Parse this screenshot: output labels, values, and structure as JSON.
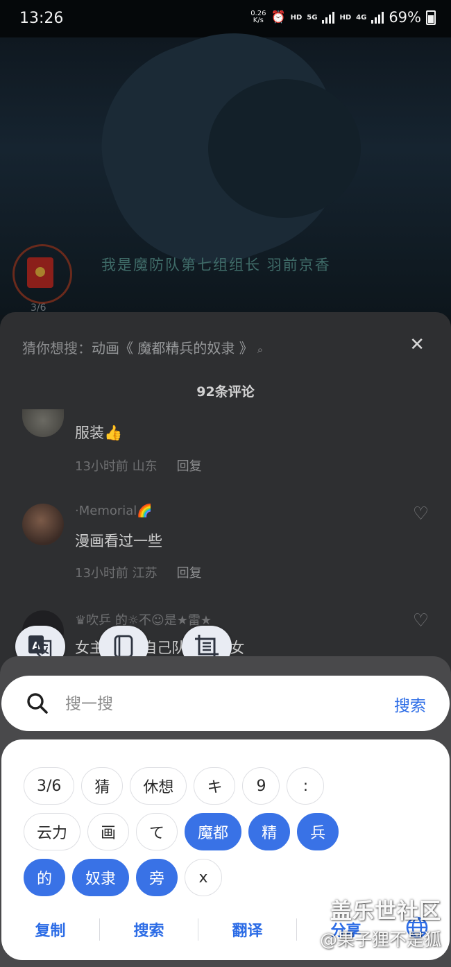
{
  "status_bar": {
    "time": "13:26",
    "net_speed_value": "0.26",
    "net_speed_unit": "K/s",
    "hd1": "HD",
    "net5g": "5G",
    "hd2": "HD",
    "net4g": "4G",
    "battery": "69%"
  },
  "video": {
    "subtitle": "我是魔防队第七组组长 羽前京香",
    "red_packet_count": "3/6"
  },
  "sheet": {
    "suggest_label": "猜你想搜：",
    "suggest_keyword": "动画《 魔都精兵的奴隶 》",
    "close": "✕",
    "comment_count": "92条评论",
    "comments": [
      {
        "text": "服装👍",
        "time": "13小时前",
        "region": "山东",
        "reply": "回复"
      },
      {
        "user": "·Memorial🌈",
        "text": "漫画看过一些",
        "time": "13小时前",
        "region": "江苏",
        "reply": "回复"
      },
      {
        "user": "♛吹乒 的☼不☺是★雷★",
        "text": "女主    长成     自己队员全是女"
      }
    ]
  },
  "search": {
    "placeholder": "搜一搜",
    "button": "搜索"
  },
  "chips": {
    "row1": [
      "3/6",
      "猜",
      "休想",
      "キ",
      "9",
      ":"
    ],
    "row2": [
      "云力",
      "画",
      "て",
      "魔都",
      "精",
      "兵"
    ],
    "row3": [
      "的",
      "奴隶",
      "旁",
      "x"
    ],
    "selected": [
      "魔都",
      "精",
      "兵",
      "的",
      "奴隶",
      "旁"
    ]
  },
  "actions": {
    "copy": "复制",
    "search": "搜索",
    "translate": "翻译",
    "share": "分享"
  },
  "watermark": {
    "line1": "盖乐世社区",
    "line2": "@果子狸不是狐"
  },
  "colors": {
    "accent": "#3972e6",
    "link": "#2c6ce6"
  }
}
